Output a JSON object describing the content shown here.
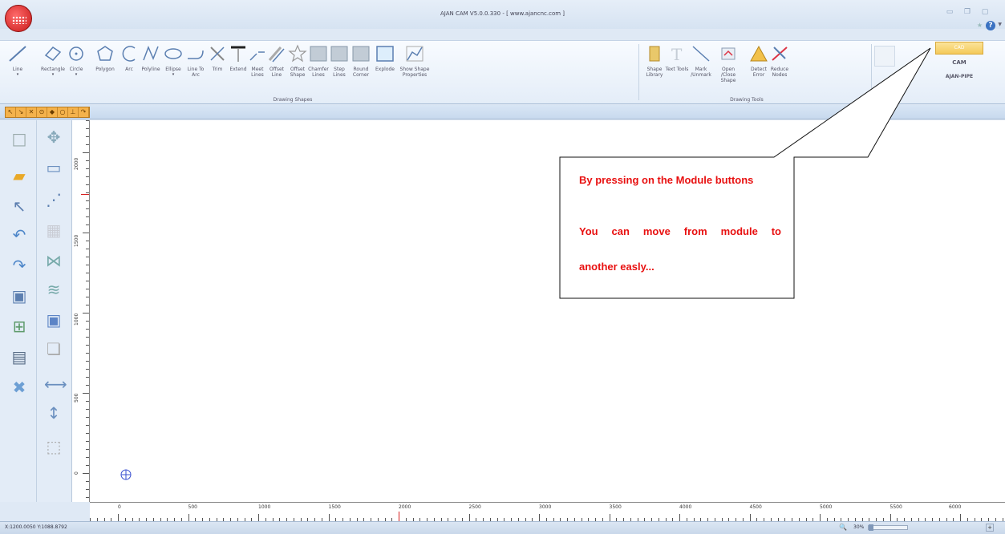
{
  "window": {
    "title": "AJAN CAM V5.0.0.330 - [ www.ajancnc.com ]",
    "controls": [
      "minimize-icon",
      "restore-icon",
      "close-icon"
    ]
  },
  "ribbon": {
    "drawing_shapes": {
      "group_label": "Drawing Shapes",
      "items": [
        {
          "label": "Line",
          "icon": "line-icon",
          "dropdown": true
        },
        {
          "label": "Rectangle",
          "icon": "rectangle-icon",
          "dropdown": true
        },
        {
          "label": "Circle",
          "icon": "circle-icon",
          "dropdown": true
        },
        {
          "label": "Polygon",
          "icon": "polygon-icon",
          "dropdown": false
        },
        {
          "label": "Arc",
          "icon": "arc-icon",
          "dropdown": false
        },
        {
          "label": "Polyline",
          "icon": "polyline-icon",
          "dropdown": false
        },
        {
          "label": "Ellipse",
          "icon": "ellipse-icon",
          "dropdown": true
        },
        {
          "label": "Line To Arc",
          "icon": "line-to-arc-icon",
          "dropdown": false
        },
        {
          "label": "Trim",
          "icon": "trim-icon",
          "dropdown": false
        },
        {
          "label": "Extend",
          "icon": "extend-icon",
          "dropdown": false
        },
        {
          "label": "Meet Lines",
          "icon": "meet-lines-icon",
          "dropdown": false
        },
        {
          "label": "Offset Line",
          "icon": "offset-line-icon",
          "dropdown": false
        },
        {
          "label": "Offset Shape",
          "icon": "offset-shape-icon",
          "dropdown": false
        },
        {
          "label": "Chamfer Lines",
          "icon": "chamfer-lines-icon",
          "dropdown": false
        },
        {
          "label": "Step Lines",
          "icon": "step-lines-icon",
          "dropdown": false
        },
        {
          "label": "Round Corner",
          "icon": "round-corner-icon",
          "dropdown": false
        },
        {
          "label": "Explode",
          "icon": "explode-icon",
          "dropdown": false
        },
        {
          "label": "Show Shape Properties",
          "icon": "shape-properties-icon",
          "dropdown": false
        }
      ]
    },
    "drawing_tools": {
      "group_label": "Drawing Tools",
      "items": [
        {
          "label": "Shape Library",
          "icon": "shape-library-icon",
          "dropdown": false
        },
        {
          "label": "Text Tools",
          "icon": "text-tools-icon",
          "dropdown": true
        },
        {
          "label": "Mark /Unmark",
          "icon": "mark-unmark-icon",
          "dropdown": false
        },
        {
          "label": "Open /Close Shape",
          "icon": "open-close-shape-icon",
          "dropdown": false
        },
        {
          "label": "Detect Error",
          "icon": "detect-error-icon",
          "dropdown": false
        },
        {
          "label": "Reduce Nodes",
          "icon": "reduce-nodes-icon",
          "dropdown": false
        }
      ]
    }
  },
  "modules": {
    "cad": "CAD",
    "cam": "CAM",
    "pipe": "AJAN-PIPE"
  },
  "snap_toolbar": [
    "snap-endpoint-icon",
    "snap-midpoint-icon",
    "snap-intersection-icon",
    "snap-center-icon",
    "snap-quadrant-icon",
    "snap-node-icon",
    "snap-perpendicular-icon",
    "snap-tangent-icon"
  ],
  "left_toolbar": {
    "col1": [
      "new-file-icon",
      "open-folder-icon",
      "select-arrow-icon",
      "undo-icon",
      "redo-icon",
      "save-icon",
      "zoom-extents-icon",
      "print-icon",
      "delete-icon"
    ],
    "col2": [
      "move-icon",
      "scale-icon",
      "rotate-nodes-icon",
      "array-icon",
      "mirror-icon",
      "wave-icon",
      "fit-icon",
      "copy-icon",
      "horizontal-measure-icon",
      "vertical-measure-icon",
      "grid-icon"
    ]
  },
  "rulers": {
    "vertical": [
      "2000",
      "1500",
      "1000",
      "500",
      "0"
    ],
    "horizontal": [
      "0",
      "500",
      "1000",
      "1500",
      "2000",
      "2500",
      "3000",
      "3500",
      "4000",
      "4500",
      "5000",
      "5500",
      "6000"
    ]
  },
  "callout": {
    "line1": "By pressing on the Module buttons",
    "line2": "You can move from module to",
    "line3": "another easly..."
  },
  "status": {
    "coordinates": "X:1200.0050 Y:1088.8792",
    "zoom": "30%"
  },
  "colors": {
    "callout_text": "#e81010",
    "cad_module": "#f4c95a",
    "snap_strip": "#f4b24c",
    "ruler_red_tick": "#d62020"
  }
}
